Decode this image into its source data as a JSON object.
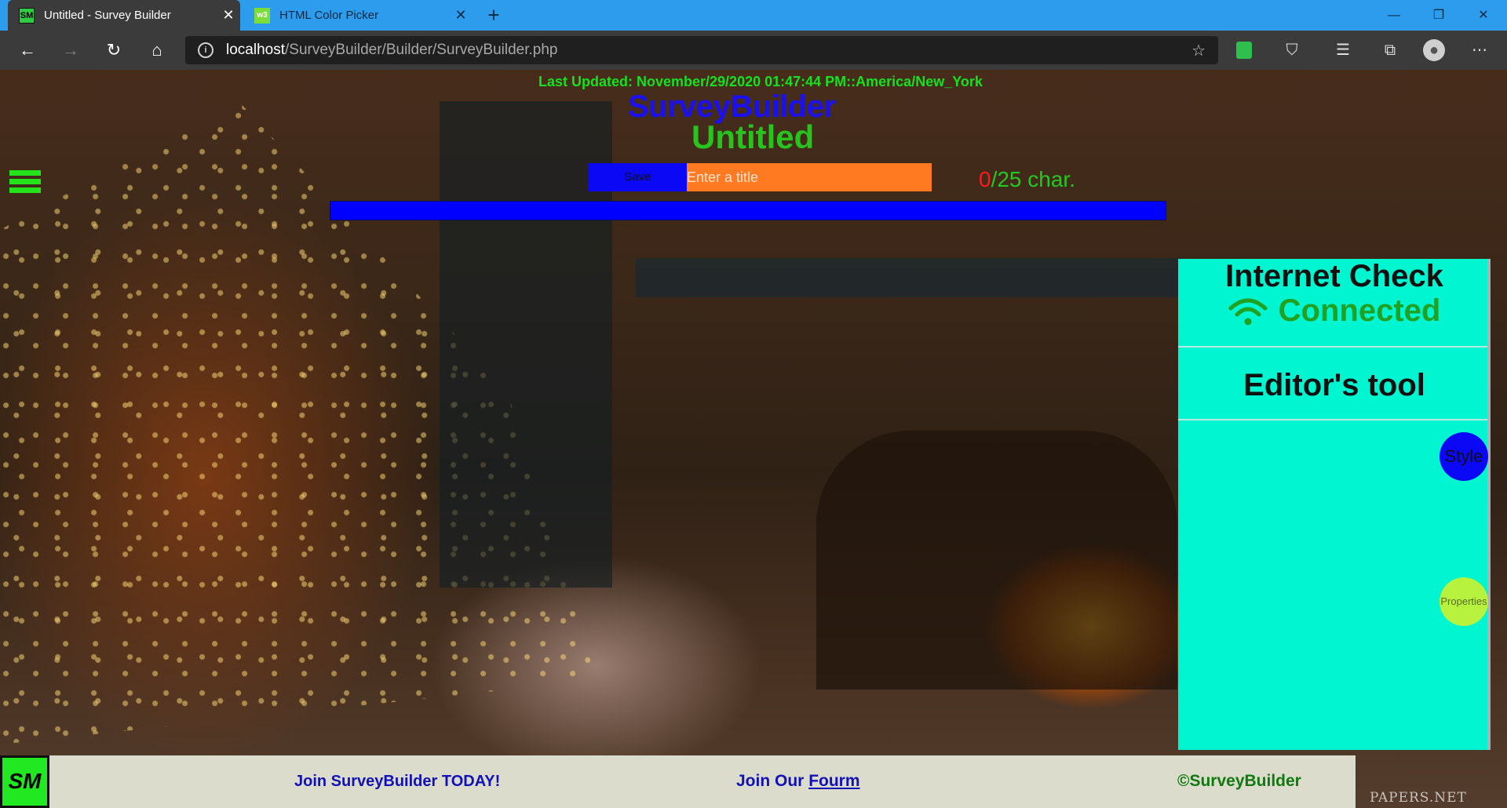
{
  "browser": {
    "tabs": [
      {
        "title": "Untitled - Survey Builder",
        "favicon": "SM",
        "active": true
      },
      {
        "title": "HTML Color Picker",
        "favicon": "w3",
        "active": false
      }
    ],
    "address": {
      "host": "localhost",
      "path": "/SurveyBuilder/Builder/SurveyBuilder.php"
    },
    "icons": [
      "back-icon",
      "forward-icon",
      "refresh-icon",
      "home-icon",
      "info-icon",
      "star-icon",
      "extension-icon",
      "shield-icon",
      "favorites-icon",
      "collections-icon",
      "profile-icon",
      "more-icon"
    ]
  },
  "page": {
    "last_updated": "Last Updated: November/29/2020 01:47:44 PM::America/New_York",
    "app_title": "SurveyBuilder",
    "survey_title": "Untitled",
    "save_label": "Save",
    "title_placeholder": "Enter a title",
    "char_used": "0",
    "char_limit": "/25 char.",
    "colors": {
      "progress": "#0000ff",
      "panel": "#00f5d0",
      "accent_green": "#27c41e"
    }
  },
  "panel": {
    "internet_check": "Internet Check",
    "status": "Connected",
    "editors_tool": "Editor's tool",
    "style_label": "Style",
    "properties_label": "Properties"
  },
  "footer": {
    "logo": "SM",
    "join": "Join SurveyBuilder TODAY!",
    "forum_prefix": "Join Our ",
    "forum_link": "Fourm",
    "copyright": "©SurveyBuilder",
    "watermark": "PAPERS.NET"
  }
}
